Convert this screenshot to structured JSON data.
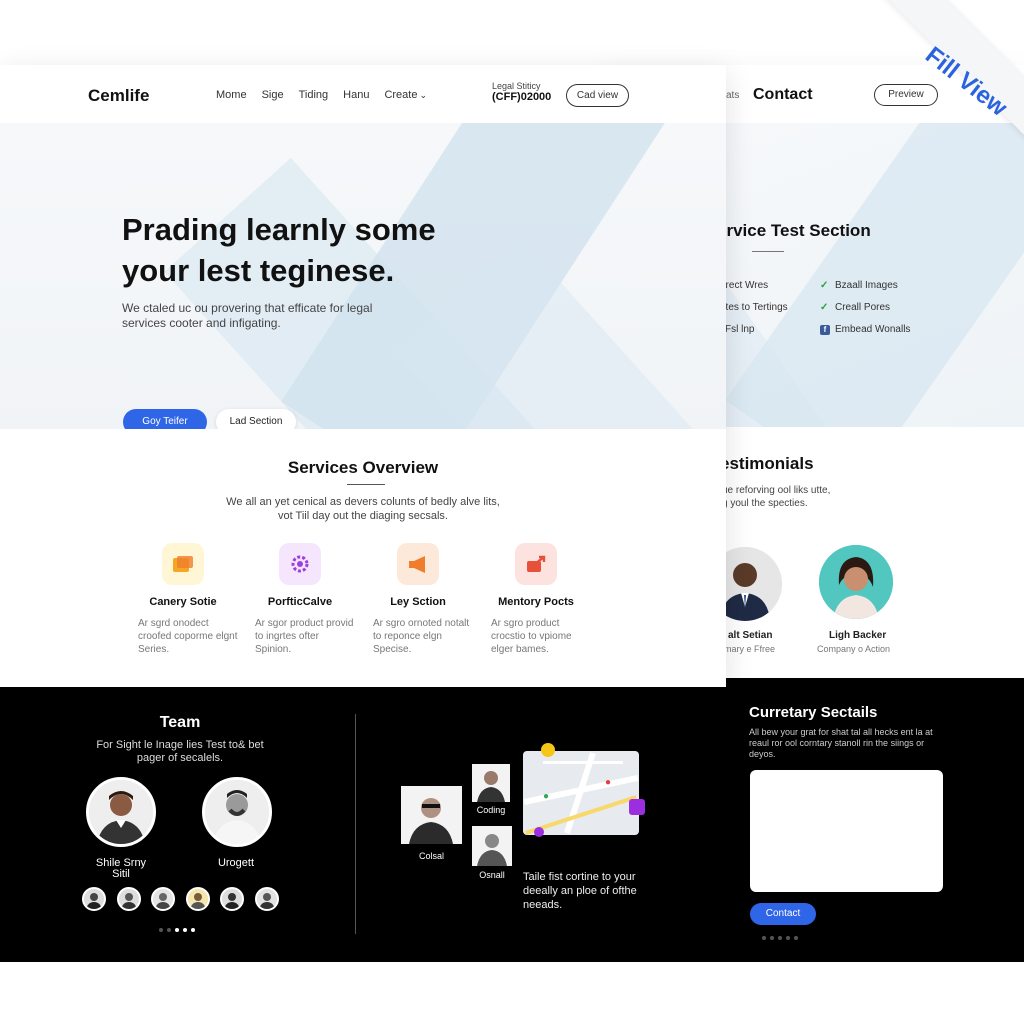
{
  "ribbon": {
    "label": "Fill View"
  },
  "back_page": {
    "nav_fragment": "ats",
    "nav_contact": "Contact",
    "nav_button": "Preview",
    "service_section": {
      "title": "ervice Test Section",
      "features_left": [
        "erect Wres",
        "ates to Tertings",
        "l Fsl lnp"
      ],
      "features_right": [
        "Bzaall Images",
        "Creall Pores",
        "Embead Wonalls"
      ]
    },
    "testimonials": {
      "title": "estimonials",
      "subtitle_line1": "ue reforving ool liks utte,",
      "subtitle_line2": "g youl the specties.",
      "people": [
        {
          "name": "alt Setian",
          "role": "mary e Ffree"
        },
        {
          "name": "Ligh Backer",
          "role": "Company o Action"
        }
      ]
    }
  },
  "nav": {
    "logo": "Cemlife",
    "links": [
      "Mome",
      "Sige",
      "Tiding",
      "Hanu",
      "Create"
    ],
    "phone_label": "Legal Stiticy",
    "phone_number": "(CFF)02000",
    "cta": "Cad view"
  },
  "hero": {
    "title_line1": "Prading learnly some",
    "title_line2": "your lest teginese.",
    "description": "We ctaled uc ou provering that efficate for legal services cooter and infigating.",
    "primary_button": "Goy Teifer",
    "secondary_button": "Lad Section"
  },
  "services": {
    "title": "Services Overview",
    "subtitle_line1": "We all an yet cenical as devers colunts of bedly alve lits,",
    "subtitle_line2": "vot Tiil day out the diaging secsals.",
    "cards": [
      {
        "name": "Canery Sotie",
        "desc": "Ar sgrd onodect croofed coporme elgnt Series.",
        "icon": "folder-icon",
        "color": "#f5a623"
      },
      {
        "name": "PorfticCalve",
        "desc": "Ar sgor product provid to ingrtes ofter Spinion.",
        "icon": "gear-icon",
        "color": "#9b3fe0"
      },
      {
        "name": "Ley Sction",
        "desc": "Ar sgro ornoted notalt to reponce elgn Specise.",
        "icon": "megaphone-icon",
        "color": "#f07d2b"
      },
      {
        "name": "Mentory Pocts",
        "desc": "Ar sgro product crocstio to vpiome elger bames.",
        "icon": "share-icon",
        "color": "#e8503a"
      }
    ]
  },
  "team": {
    "title": "Team",
    "subtitle_line1": "For Sight le Inage lies Test to& bet",
    "subtitle_line2": "pager of secalels.",
    "members": [
      {
        "name_line1": "Shile Srny",
        "name_line2": "Sitil"
      },
      {
        "name_line1": "Urogett",
        "name_line2": ""
      }
    ]
  },
  "collage": {
    "labels": [
      "Colsal",
      "Coding",
      "Osnall"
    ],
    "text": "Taile fist cortine to your deeally an ploe of ofthe neeads."
  },
  "curatory": {
    "title": "Curretary Sectails",
    "subtitle": "All bew your grat for shat tal all hecks ent la at reaul ror ool corntary stanoll rin the siings or deyos.",
    "button": "Contact"
  },
  "colors": {
    "accent": "#2f66e8",
    "dark": "#000000",
    "hero_band": "#c6dceb"
  }
}
